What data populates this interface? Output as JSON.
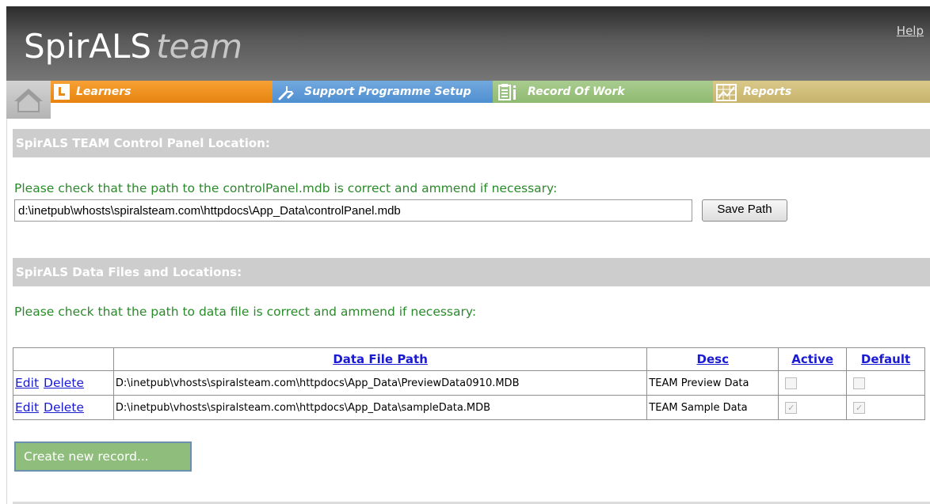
{
  "header": {
    "logo_main": "SpirALS",
    "logo_sub": "team",
    "help_label": "Help"
  },
  "tabs": [
    {
      "label": "Learners",
      "icon": "learner-l-icon",
      "color": "#e98b18"
    },
    {
      "label": "Support Programme Setup",
      "icon": "tools-icon",
      "color": "#5a96d4"
    },
    {
      "label": "Record Of Work",
      "icon": "clipboard-icon",
      "color": "#98c07a"
    },
    {
      "label": "Reports",
      "icon": "reports-chart-icon",
      "color": "#cdbb74"
    }
  ],
  "control_panel": {
    "title": "SpirALS TEAM Control Panel Location:",
    "instruction": "Please check that the path to the controlPanel.mdb is correct and ammend if necessary:",
    "path_value": "d:\\inetpub\\whosts\\spiralsteam.com\\httpdocs\\App_Data\\controlPanel.mdb",
    "save_label": "Save Path"
  },
  "data_files": {
    "title": "SpirALS Data Files and Locations:",
    "instruction": "Please check that the path to data file is correct and ammend if necessary:",
    "columns": [
      "",
      "Data File Path",
      "Desc",
      "Active",
      "Default"
    ],
    "rows": [
      {
        "edit": "Edit",
        "delete": "Delete",
        "path": "D:\\inetpub\\vhosts\\spiralsteam.com\\httpdocs\\App_Data\\PreviewData0910.MDB",
        "desc": "TEAM Preview Data",
        "active": false,
        "default": false
      },
      {
        "edit": "Edit",
        "delete": "Delete",
        "path": "D:\\inetpub\\vhosts\\spiralsteam.com\\httpdocs\\App_Data\\sampleData.MDB",
        "desc": "TEAM Sample Data",
        "active": true,
        "default": true
      }
    ],
    "create_label": "Create new record..."
  }
}
